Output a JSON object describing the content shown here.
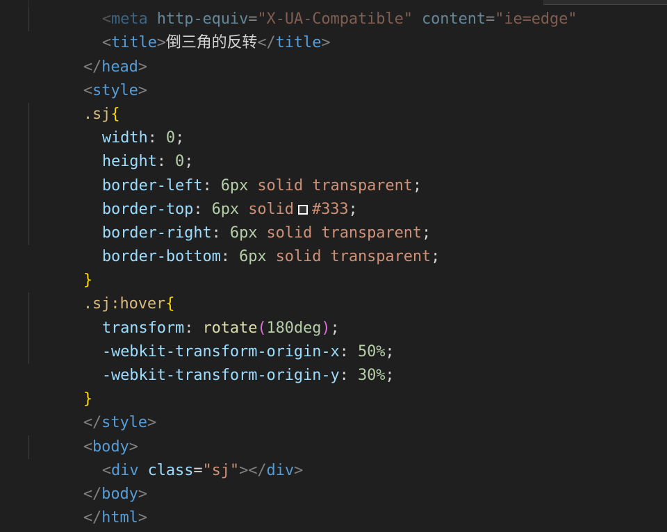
{
  "colors": {
    "background": "#1f1f1f",
    "swatch": "#333333"
  },
  "lines": {
    "l0": {
      "bracket_open": "<",
      "tag": "meta",
      "attr1": " http-equiv",
      "eq1": "=",
      "str1": "\"X-UA-Compatible\"",
      "attr2": " content",
      "eq2": "=",
      "str2": "\"ie=edge\""
    },
    "l1": {
      "bracket_open": "<",
      "tag": "title",
      "bracket_close": ">",
      "text": "倒三角的反转",
      "end_open": "</",
      "end_tag": "title",
      "end_close": ">"
    },
    "l2": {
      "bracket_open": "</",
      "tag": "head",
      "bracket_close": ">"
    },
    "l3": {
      "bracket_open": "<",
      "tag": "style",
      "bracket_close": ">"
    },
    "l4": {
      "selector": ".sj",
      "brace": "{"
    },
    "l5": {
      "prop": "width",
      "colon": ": ",
      "num": "0",
      "semi": ";"
    },
    "l6": {
      "prop": "height",
      "colon": ": ",
      "num": "0",
      "semi": ";"
    },
    "l7": {
      "prop": "border-left",
      "colon": ": ",
      "num": "6px",
      "sp1": " ",
      "val1": "solid",
      "sp2": " ",
      "val2": "transparent",
      "semi": ";"
    },
    "l8": {
      "prop": "border-top",
      "colon": ": ",
      "num": "6px",
      "sp1": " ",
      "val1": "solid",
      "val2": "#333",
      "semi": ";"
    },
    "l9": {
      "prop": "border-right",
      "colon": ": ",
      "num": "6px",
      "sp1": " ",
      "val1": "solid",
      "sp2": " ",
      "val2": "transparent",
      "semi": ";"
    },
    "l10": {
      "prop": "border-bottom",
      "colon": ": ",
      "num": "6px",
      "sp1": " ",
      "val1": "solid",
      "sp2": " ",
      "val2": "transparent",
      "semi": ";"
    },
    "l11": {
      "brace": "}"
    },
    "l12": {
      "selector": ".sj:hover",
      "brace": "{"
    },
    "l13": {
      "prop": "transform",
      "colon": ": ",
      "func": "rotate",
      "paren_open": "(",
      "num": "180deg",
      "paren_close": ")",
      "semi": ";"
    },
    "l14": {
      "prop": "-webkit-transform-origin-x",
      "colon": ": ",
      "num": "50%",
      "semi": ";"
    },
    "l15": {
      "prop": "-webkit-transform-origin-y",
      "colon": ": ",
      "num": "30%",
      "semi": ";"
    },
    "l16": {
      "brace": "}"
    },
    "l17": {
      "bracket_open": "</",
      "tag": "style",
      "bracket_close": ">"
    },
    "l18": {
      "bracket_open": "<",
      "tag": "body",
      "bracket_close": ">"
    },
    "l19": {
      "bracket_open": "<",
      "tag": "div",
      "attr": " class",
      "eq": "=",
      "str": "\"sj\"",
      "bracket_close": ">",
      "end_open": "</",
      "end_tag": "div",
      "end_close": ">"
    },
    "l20": {
      "bracket_open": "</",
      "tag": "body",
      "bracket_close": ">"
    },
    "l21": {
      "bracket_open": "</",
      "tag": "html",
      "bracket_close": ">"
    }
  }
}
